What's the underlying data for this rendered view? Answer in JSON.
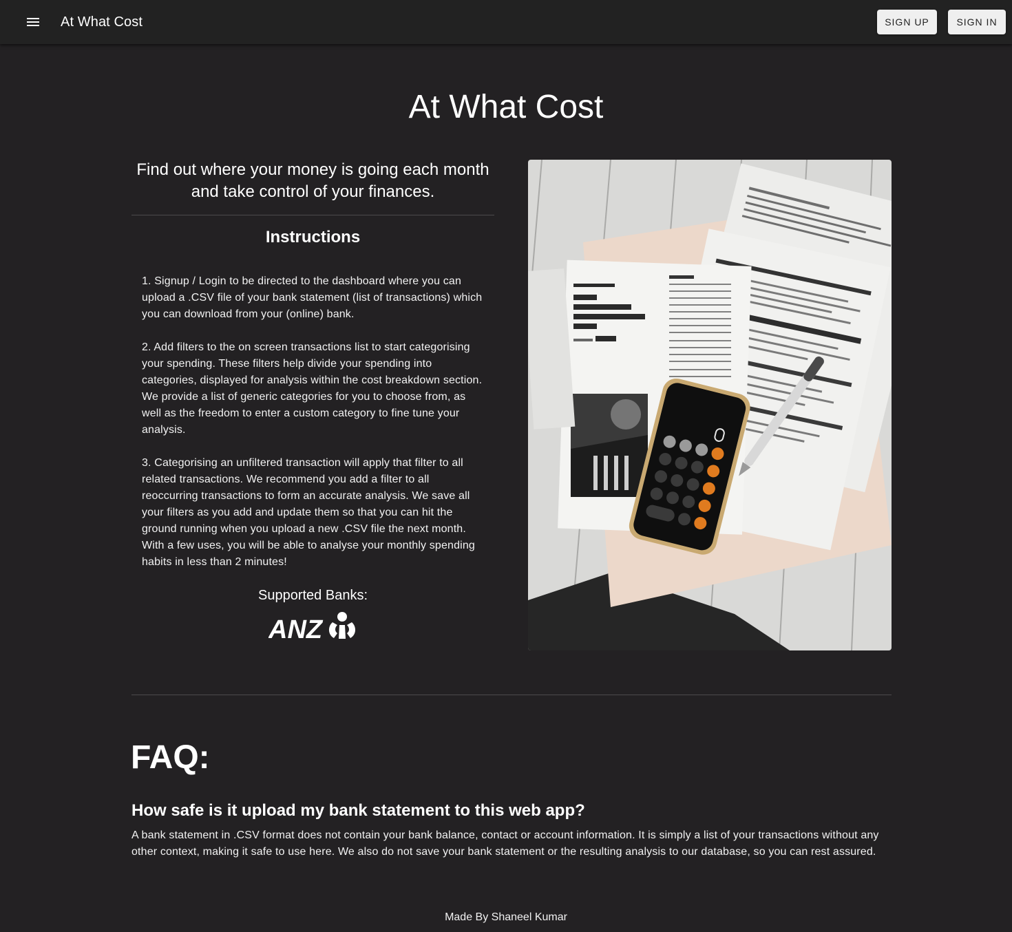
{
  "appbar": {
    "title": "At What Cost",
    "menu_icon": "menu-icon",
    "signup_label": "SIGN UP",
    "signin_label": "SIGN IN"
  },
  "hero": {
    "title": "At What Cost",
    "tagline": "Find out where your money is going each month and take control of your finances.",
    "image_alt": "Tax forms with a calculator phone and pen on a white wooden table"
  },
  "instructions": {
    "title": "Instructions",
    "steps": [
      "1. Signup / Login to be directed to the dashboard where you can upload a .CSV file of your bank statement (list of transactions) which you can download from your (online) bank.",
      "2. Add filters to the on screen transactions list to start categorising your spending. These filters help divide your spending into categories, displayed for analysis within the cost breakdown section. We provide a list of generic categories for you to choose from, as well as the freedom to enter a custom category to fine tune your analysis.",
      "3. Categorising an unfiltered transaction will apply that filter to all related transactions. We recommend you add a filter to all reoccurring transactions to form an accurate analysis. We save all your filters as you add and update them so that you can hit the ground running when you upload a new .CSV file the next month. With a few uses, you will be able to analyse your monthly spending habits in less than 2 minutes!"
    ]
  },
  "banks": {
    "label": "Supported Banks:",
    "logos": [
      {
        "name": "ANZ",
        "logo_text": "ANZ"
      }
    ]
  },
  "faq": {
    "title": "FAQ:",
    "items": [
      {
        "question": "How safe is it upload my bank statement to this web app?",
        "answer": "A bank statement in .CSV format does not contain your bank balance, contact or account information. It is simply a list of your transactions without any other context, making it safe to use here. We also do not save your bank statement or the resulting analysis to our database, so you can rest assured."
      }
    ]
  },
  "footer": {
    "text": "Made By Shaneel Kumar"
  },
  "colors": {
    "background": "#232123",
    "appbar": "#222222",
    "button_bg": "#efefef",
    "text": "#ffffff",
    "divider": "#4d4b4d"
  }
}
